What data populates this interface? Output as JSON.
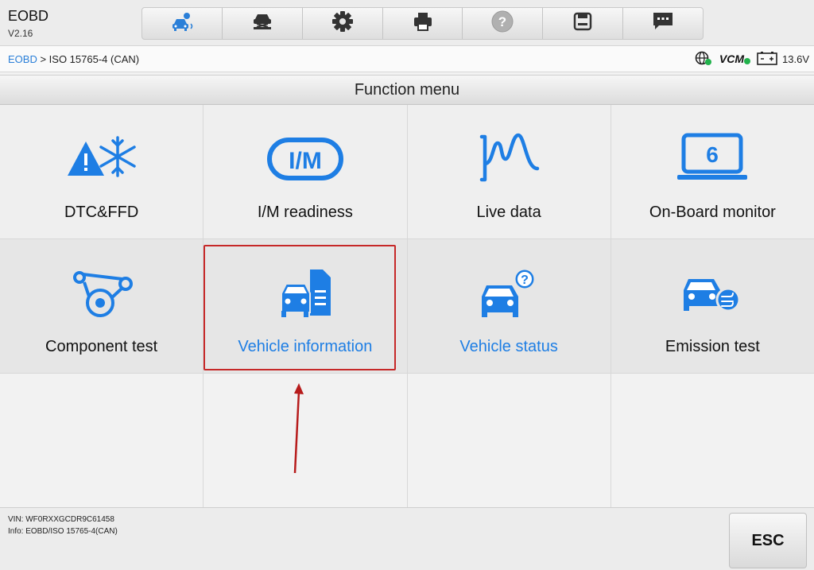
{
  "app": {
    "name": "EOBD",
    "version": "V2.16"
  },
  "toolbar": {
    "icons": [
      "vehicle-diagnostics-icon",
      "car-lift-icon",
      "gear-icon",
      "printer-icon",
      "help-icon",
      "save-icon",
      "message-icon"
    ],
    "active_color": "#2a7fd8"
  },
  "breadcrumb": {
    "root": "EOBD",
    "separator": " > ",
    "current": "ISO 15765-4 (CAN)"
  },
  "status": {
    "vcm_label": "VCM",
    "voltage": "13.6V"
  },
  "menu": {
    "title": "Function menu",
    "items": [
      {
        "label": "DTC&FFD",
        "icon": "warning-snowflake-icon"
      },
      {
        "label": "I/M readiness",
        "icon": "im-badge-icon"
      },
      {
        "label": "Live data",
        "icon": "waveform-icon"
      },
      {
        "label": "On-Board monitor",
        "icon": "laptop-6-icon"
      },
      {
        "label": "Component test",
        "icon": "belt-pulley-icon"
      },
      {
        "label": "Vehicle information",
        "icon": "car-document-icon"
      },
      {
        "label": "Vehicle status",
        "icon": "car-question-icon"
      },
      {
        "label": "Emission test",
        "icon": "car-exhaust-icon"
      }
    ],
    "accent_color": "#1e7ee4",
    "highlight_color": "#c62828"
  },
  "footer": {
    "vin": "VIN: WF0RXXGCDR9C61458",
    "info": "Info: EOBD/ISO 15765-4(CAN)",
    "esc_label": "ESC"
  }
}
